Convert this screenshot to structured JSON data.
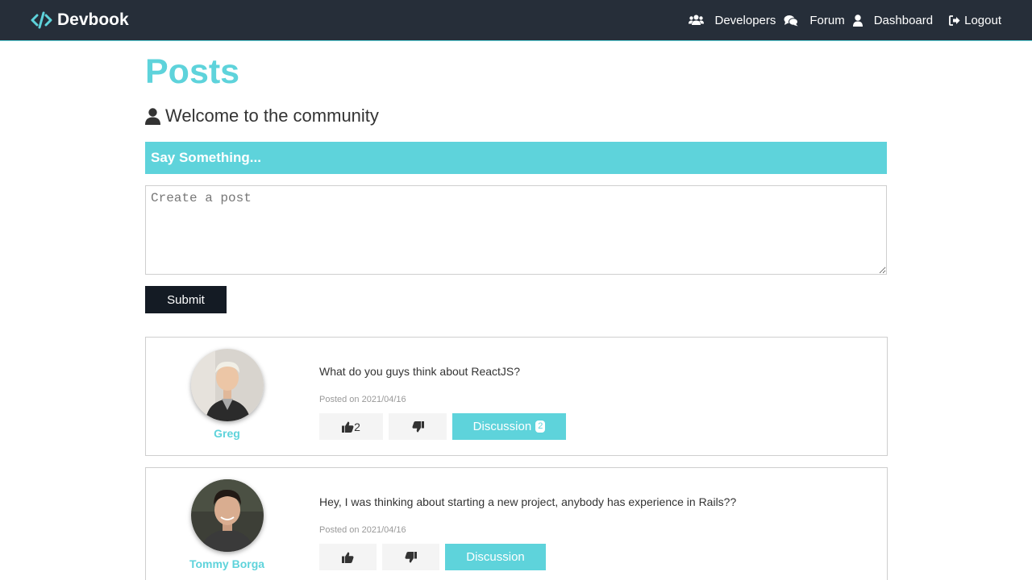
{
  "nav": {
    "brand": "Devbook",
    "links": [
      {
        "label": "Developers",
        "icon": "users-icon"
      },
      {
        "label": "Forum",
        "icon": "comments-icon"
      },
      {
        "label": "Dashboard",
        "icon": "user-icon"
      },
      {
        "label": "Logout",
        "icon": "sign-out-icon"
      }
    ]
  },
  "page": {
    "title": "Posts",
    "lead": "Welcome to the community"
  },
  "form": {
    "header": "Say Something...",
    "placeholder": "Create a post",
    "submit": "Submit"
  },
  "posts": [
    {
      "author": "Greg",
      "text": "What do you guys think about ReactJS?",
      "date_prefix": "Posted on",
      "date": "2021/04/16",
      "likes": "2",
      "discussion_label": "Discussion",
      "comment_count": "2"
    },
    {
      "author": "Tommy Borga",
      "text": "Hey, I was thinking about starting a new project, anybody has experience in Rails??",
      "date_prefix": "Posted on",
      "date": "2021/04/16",
      "likes": "",
      "discussion_label": "Discussion",
      "comment_count": ""
    }
  ],
  "colors": {
    "primary": "#5ed3db",
    "navbar": "#262e39",
    "dark_button": "#141b24"
  }
}
